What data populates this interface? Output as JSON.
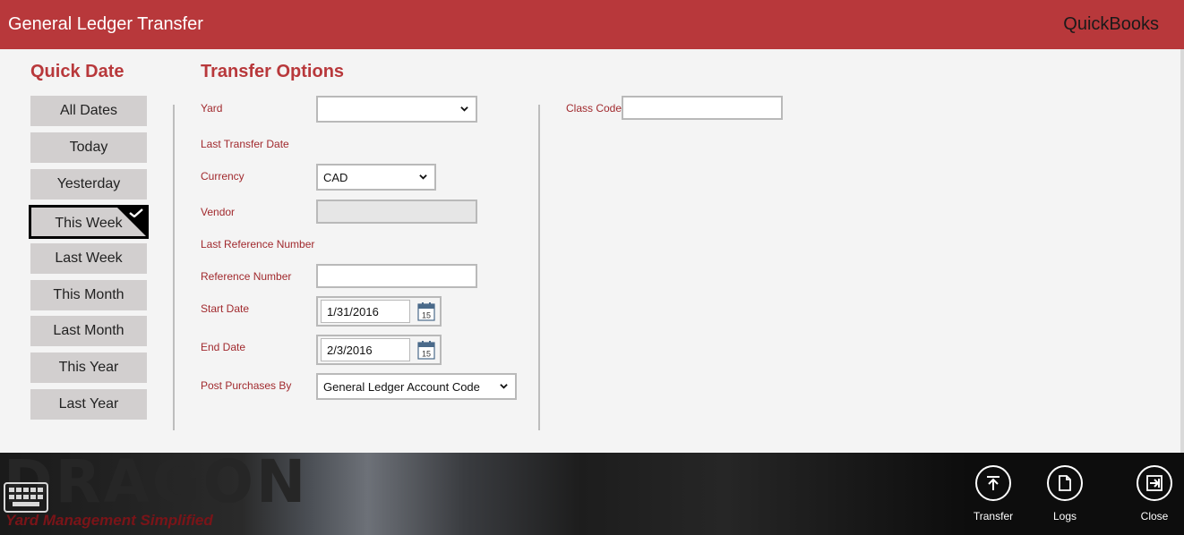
{
  "window": {
    "title": "General Ledger Transfer",
    "brand": "QuickBooks"
  },
  "quick_date": {
    "title": "Quick Date",
    "selected": "This Week",
    "items": [
      "All Dates",
      "Today",
      "Yesterday",
      "This Week",
      "Last Week",
      "This Month",
      "Last Month",
      "This Year",
      "Last Year"
    ]
  },
  "transfer_options": {
    "title": "Transfer Options",
    "yard": {
      "label": "Yard",
      "value": ""
    },
    "last_transfer_date": {
      "label": "Last Transfer Date",
      "value": ""
    },
    "currency": {
      "label": "Currency",
      "value": "CAD"
    },
    "vendor": {
      "label": "Vendor",
      "value": ""
    },
    "last_reference_number": {
      "label": "Last Reference Number",
      "value": ""
    },
    "reference_number": {
      "label": "Reference Number",
      "value": ""
    },
    "start_date": {
      "label": "Start Date",
      "value": "1/31/2016",
      "calendar_day": "15"
    },
    "end_date": {
      "label": "End Date",
      "value": "2/3/2016",
      "calendar_day": "15"
    },
    "post_purchases_by": {
      "label": "Post Purchases By",
      "value": "General Ledger Account Code"
    },
    "class_code": {
      "label": "Class Code",
      "value": ""
    }
  },
  "branding": {
    "logo_text": "DRAGON",
    "tagline": "Yard Management Simplified"
  },
  "appbar": {
    "transfer_label": "Transfer",
    "logs_label": "Logs",
    "close_label": "Close"
  },
  "colors": {
    "accent": "#b8383b",
    "panel_bg": "#f4f4f4",
    "label_text": "#a12a2e"
  }
}
